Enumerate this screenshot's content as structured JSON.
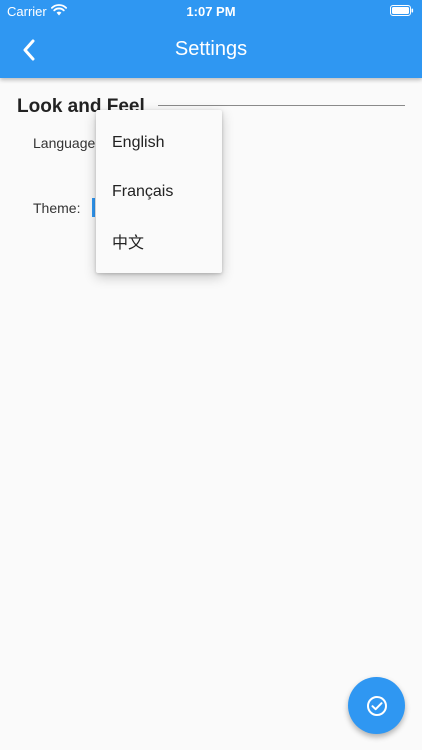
{
  "status_bar": {
    "carrier": "Carrier",
    "time": "1:07 PM"
  },
  "app_bar": {
    "title": "Settings",
    "back_icon": "chevron-left-icon"
  },
  "section": {
    "title": "Look and Feel"
  },
  "fields": {
    "language_label": "Language:",
    "theme_label": "Theme:"
  },
  "language_dropdown": {
    "options": [
      "English",
      "Français",
      "中文"
    ]
  },
  "fab": {
    "icon": "check-circle-icon"
  },
  "colors": {
    "primary": "#2f97f2",
    "background": "#fafafa"
  }
}
